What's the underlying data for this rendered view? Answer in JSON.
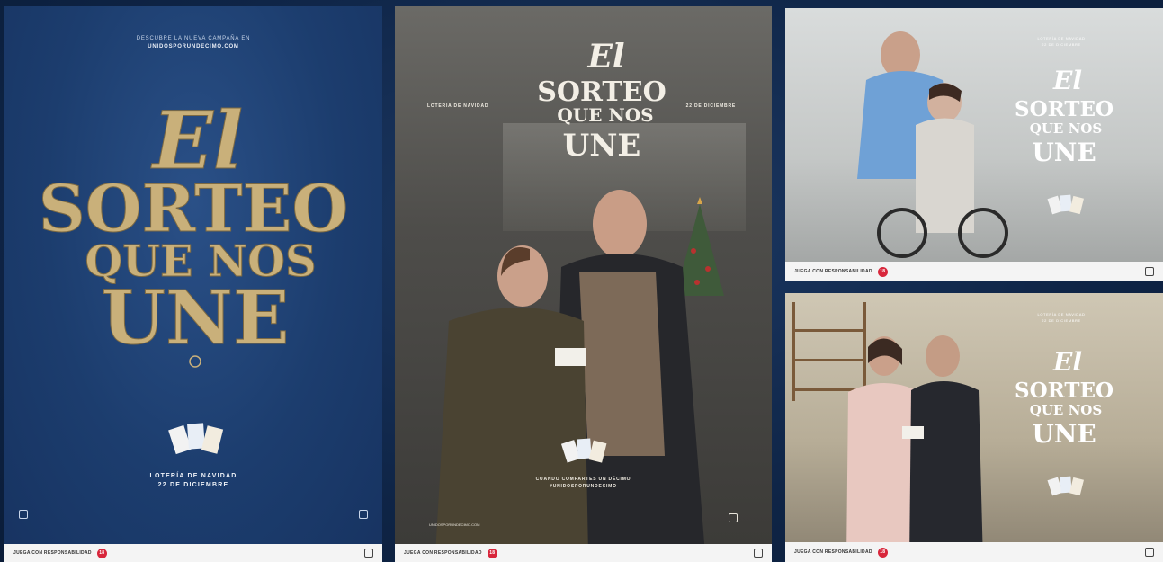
{
  "poster1": {
    "top_line": "DESCUBRE LA NUEVA CAMPAÑA EN",
    "top_url": "UNIDOSPORUNDECIMO.COM",
    "title_1": "El",
    "title_2": "SORTEO",
    "title_3": "QUE NOS",
    "title_4": "UNE",
    "bottom_1": "LOTERÍA DE NAVIDAD",
    "bottom_2": "22 DE DICIEMBRE",
    "footer": "JUEGA CON RESPONSABILIDAD",
    "age": "18"
  },
  "poster2": {
    "left_label": "LOTERÍA DE NAVIDAD",
    "right_label": "22 DE DICIEMBRE",
    "title_1": "El",
    "title_2": "SORTEO",
    "title_3": "QUE NOS",
    "title_4": "UNE",
    "caption_1": "CUANDO COMPARTES UN DÉCIMO",
    "caption_2": "#UNIDOSPORUNDECIMO",
    "url": "UNIDOSPORUNDECIMO.COM",
    "footer": "JUEGA CON RESPONSABILIDAD",
    "age": "18"
  },
  "poster3": {
    "label_1": "LOTERÍA DE NAVIDAD",
    "label_2": "22 DE DICIEMBRE",
    "title_1": "El",
    "title_2": "SORTEO",
    "title_3": "QUE NOS",
    "title_4": "UNE",
    "footer": "JUEGA CON RESPONSABILIDAD",
    "age": "18"
  },
  "poster4": {
    "label_1": "LOTERÍA DE NAVIDAD",
    "label_2": "22 DE DICIEMBRE",
    "title_1": "El",
    "title_2": "SORTEO",
    "title_3": "QUE NOS",
    "title_4": "UNE",
    "footer": "JUEGA CON RESPONSABILIDAD",
    "age": "18"
  },
  "colors": {
    "gold": "#c9b07a",
    "navy": "#1c3d6e",
    "white_title": "#f3efe6"
  }
}
